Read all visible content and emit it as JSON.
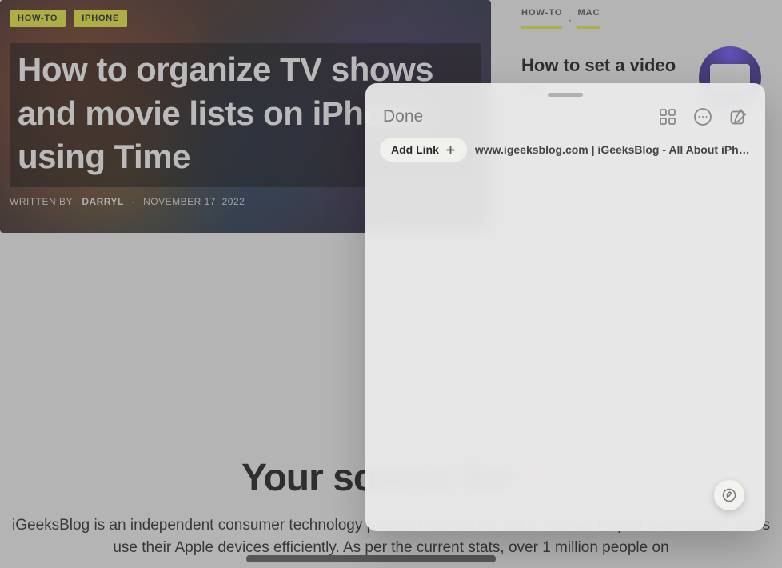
{
  "hero": {
    "tags": [
      "HOW-TO",
      "IPHONE"
    ],
    "title": "How to organize TV shows and movie lists on iPhone using Time",
    "written_by_label": "WRITTEN BY",
    "author": "DARRYL",
    "date": "NOVEMBER 17, 2022"
  },
  "sidebar": {
    "tags": [
      "HOW-TO",
      "MAC"
    ],
    "comma": ",",
    "article_title": "How to set a video as"
  },
  "source": {
    "heading_pre": "Your source for ",
    "heading_highlight": "'I",
    "body": "iGeeksBlog is an independent consumer technology platform founded in 2012 that has helped 345 million+ users use their Apple devices efficiently. As per the current stats, over 1 million people on"
  },
  "panel": {
    "done": "Done",
    "add_link": "Add Link",
    "link_text": "www.igeeksblog.com | iGeeksBlog - All About iPhone,..."
  }
}
